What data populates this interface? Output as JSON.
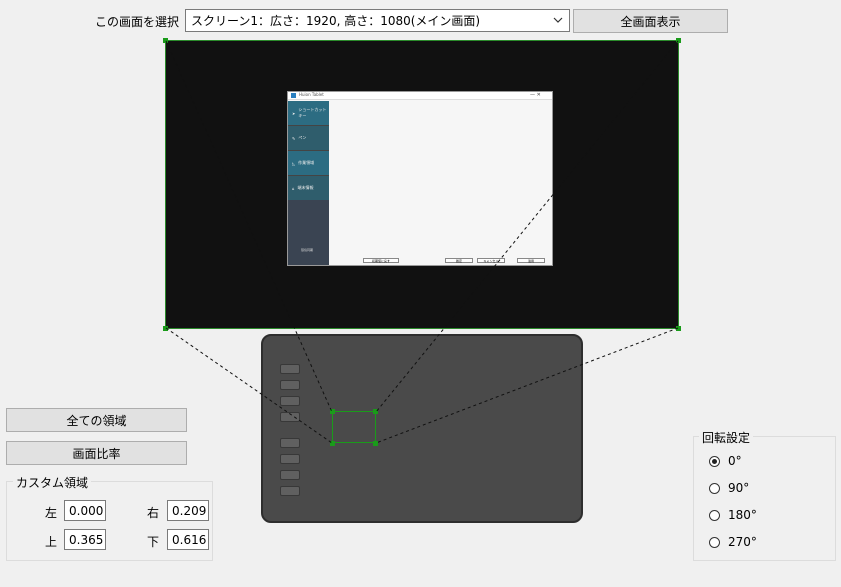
{
  "screen_select": {
    "label": "この画面を選択",
    "selected": "スクリーン1：広さ：1920, 高さ：1080(メイン画面)",
    "fullscreen_button": "全画面表示"
  },
  "preview_app": {
    "title": "Huion Tablet",
    "menu": [
      "ショートカットキー",
      "ペン",
      "作業領域",
      "端末情報"
    ],
    "sidebar_footer": "環境同期",
    "buttons": [
      "初期値に戻す",
      "確定",
      "キャンセル",
      "適用"
    ]
  },
  "area_buttons": {
    "all": "全ての領域",
    "ratio": "画面比率"
  },
  "custom_area": {
    "title": "カスタム領域",
    "left_label": "左",
    "left_value": "0.000",
    "right_label": "右",
    "right_value": "0.209",
    "top_label": "上",
    "top_value": "0.365",
    "bottom_label": "下",
    "bottom_value": "0.616"
  },
  "rotation": {
    "title": "回転設定",
    "options": [
      "0°",
      "90°",
      "180°",
      "270°"
    ],
    "selected": "0°"
  },
  "colors": {
    "accent_green": "#1a9b1a",
    "window_bg": "#f0f0f0"
  }
}
